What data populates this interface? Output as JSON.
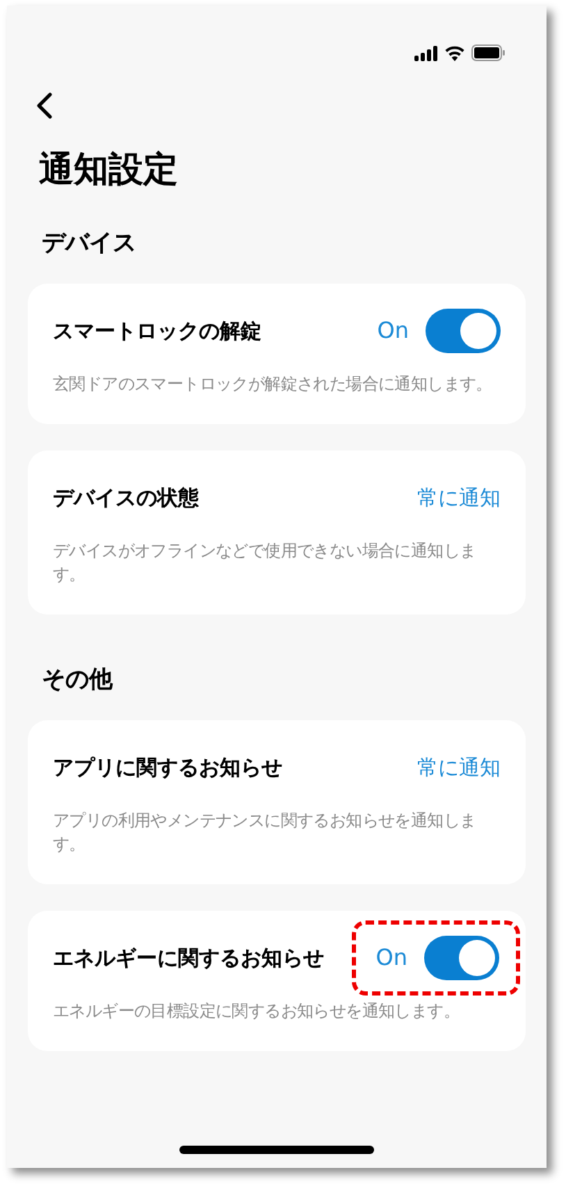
{
  "title": "通知設定",
  "sections": [
    {
      "heading": "デバイス",
      "items": [
        {
          "kind": "toggle",
          "title": "スマートロックの解錠",
          "state_label": "On",
          "on": true,
          "highlighted": false,
          "description": "玄関ドアのスマートロックが解錠された場合に通知します。"
        },
        {
          "kind": "link",
          "title": "デバイスの状態",
          "action": "常に通知",
          "highlighted": false,
          "description": "デバイスがオフラインなどで使用できない場合に通知します。"
        }
      ]
    },
    {
      "heading": "その他",
      "items": [
        {
          "kind": "link",
          "title": "アプリに関するお知らせ",
          "action": "常に通知",
          "highlighted": false,
          "description": "アプリの利用やメンテナンスに関するお知らせを通知します。"
        },
        {
          "kind": "toggle",
          "title": "エネルギーに関するお知らせ",
          "state_label": "On",
          "on": true,
          "highlighted": true,
          "description": "エネルギーの目標設定に関するお知らせを通知します。"
        }
      ]
    }
  ]
}
